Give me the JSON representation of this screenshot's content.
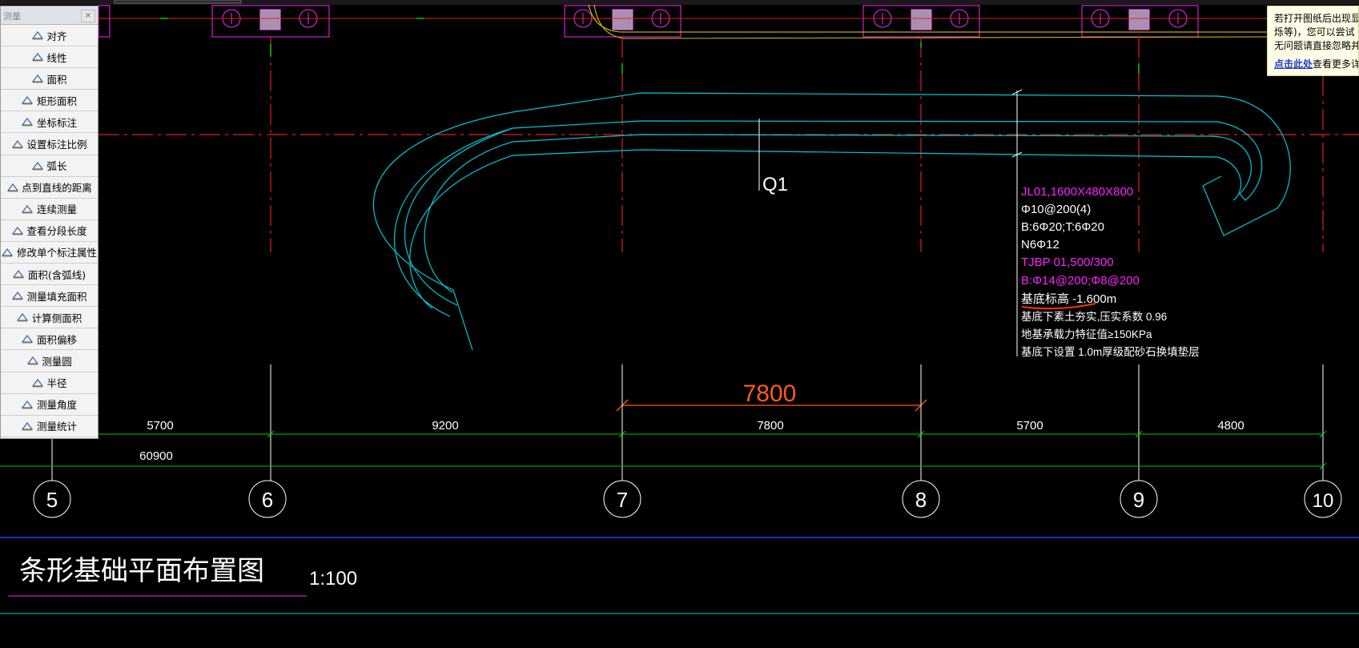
{
  "panel": {
    "title": "测量",
    "close": "×",
    "tools": [
      {
        "label": "对齐",
        "icon": "align-icon"
      },
      {
        "label": "线性",
        "icon": "linear-dimension-icon"
      },
      {
        "label": "面积",
        "icon": "area-icon"
      },
      {
        "label": "矩形面积",
        "icon": "rect-area-icon"
      },
      {
        "label": "坐标标注",
        "icon": "coordinate-icon"
      },
      {
        "label": "设置标注比例",
        "icon": "scale-icon"
      },
      {
        "label": "弧长",
        "icon": "arc-length-icon"
      },
      {
        "label": "点到直线的距离",
        "icon": "point-line-icon"
      },
      {
        "label": "连续测量",
        "icon": "continuous-measure-icon"
      },
      {
        "label": "查看分段长度",
        "icon": "segment-length-icon"
      },
      {
        "label": "修改单个标注属性",
        "icon": "edit-dimension-icon"
      },
      {
        "label": "面积(含弧线)",
        "icon": "arc-area-icon"
      },
      {
        "label": "测量填充面积",
        "icon": "fill-area-icon"
      },
      {
        "label": "计算侧面积",
        "icon": "side-area-icon"
      },
      {
        "label": "面积偏移",
        "icon": "area-offset-icon"
      },
      {
        "label": "测量圆",
        "icon": "circle-icon"
      },
      {
        "label": "半径",
        "icon": "radius-icon"
      },
      {
        "label": "测量角度",
        "icon": "angle-icon"
      },
      {
        "label": "测量统计",
        "icon": "statistics-icon"
      }
    ]
  },
  "notice": {
    "line1": "若打开图纸后出现显",
    "line2": "烁等)，您可以尝试",
    "line3": "无问题请直接忽略并",
    "link": "点击此处",
    "link_suffix": "查看更多详"
  },
  "drawing": {
    "wall_label": "Q1",
    "beam_label": "JL01,1600X480X800",
    "stirrup": "Φ10@200(4)",
    "bars": "B:6Φ20;T:6Φ20",
    "side_bars": "N6Φ12",
    "footing": "TJBP 01,500/300",
    "footing_bars": "B:Φ14@200;Φ8@200",
    "base_elev": "基底标高 -1.600m",
    "note1": "基底下素土夯实,压实系数 0.96",
    "note2": "地基承载力特征值≥150KPa",
    "note3": "基底下设置 1.0m厚级配砂石换填垫层",
    "measure_value": "7800",
    "dims": [
      "5700",
      "9200",
      "7800",
      "5700",
      "4800"
    ],
    "total_dim": "60900",
    "axes": [
      "5",
      "6",
      "7",
      "8",
      "9",
      "10"
    ],
    "title": "条形基础平面布置图",
    "scale": "1:100"
  },
  "colors": {
    "cyan": "#00c8d8",
    "magenta": "#ff22ff",
    "red": "#e02020",
    "green": "#00c800",
    "orange": "#ff5a1a",
    "grid": "#ffffff"
  }
}
